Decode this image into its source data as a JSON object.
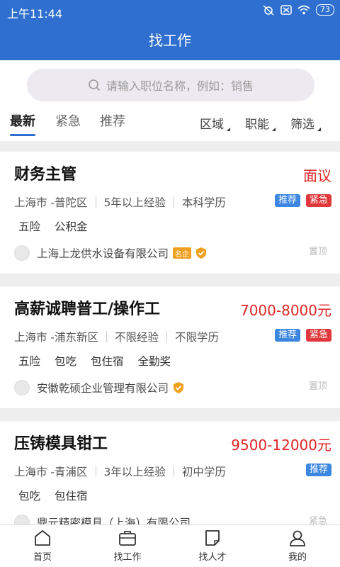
{
  "status": {
    "time": "上午11:44",
    "battery": "73"
  },
  "header": {
    "title": "找工作"
  },
  "search": {
    "placeholder": "请输入职位名称，例如：销售"
  },
  "tabs": [
    {
      "label": "最新",
      "active": true
    },
    {
      "label": "紧急",
      "active": false
    },
    {
      "label": "推荐",
      "active": false
    }
  ],
  "filters": [
    {
      "label": "区域"
    },
    {
      "label": "职能"
    },
    {
      "label": "筛选"
    }
  ],
  "jobs": [
    {
      "title": "财务主管",
      "salary": "面议",
      "location": "上海市 -普陀区",
      "experience": "5年以上经验",
      "education": "本科学历",
      "badges": [
        "推荐",
        "紧急"
      ],
      "perks": [
        "五险",
        "公积金"
      ],
      "company": "上海上龙供水设备有限公司",
      "vip_label": "名企",
      "pin_label": "置顶"
    },
    {
      "title": "高薪诚聘普工/操作工",
      "salary": "7000-8000元",
      "location": "上海市 -浦东新区",
      "experience": "不限经验",
      "education": "不限学历",
      "badges": [
        "推荐",
        "紧急"
      ],
      "perks": [
        "五险",
        "包吃",
        "包住宿",
        "全勤奖"
      ],
      "company": "安徽乾硕企业管理有限公司",
      "pin_label": "置顶"
    },
    {
      "title": "压铸模具钳工",
      "salary": "9500-12000元",
      "location": "上海市 -青浦区",
      "experience": "3年以上经验",
      "education": "初中学历",
      "badges": [
        "推荐"
      ],
      "perks": [
        "包吃",
        "包住宿"
      ],
      "company": "鼎元精密模具（上海）有限公司",
      "pin_label": "紧急"
    }
  ],
  "bottom_nav": [
    {
      "label": "首页",
      "icon": "home-icon"
    },
    {
      "label": "找工作",
      "icon": "briefcase-icon"
    },
    {
      "label": "找人才",
      "icon": "resume-icon"
    },
    {
      "label": "我的",
      "icon": "user-icon"
    }
  ],
  "colors": {
    "primary": "#2f6fcf",
    "salary": "#e02424",
    "badge_recommend": "#3a86e0",
    "badge_urgent": "#e0383b"
  }
}
